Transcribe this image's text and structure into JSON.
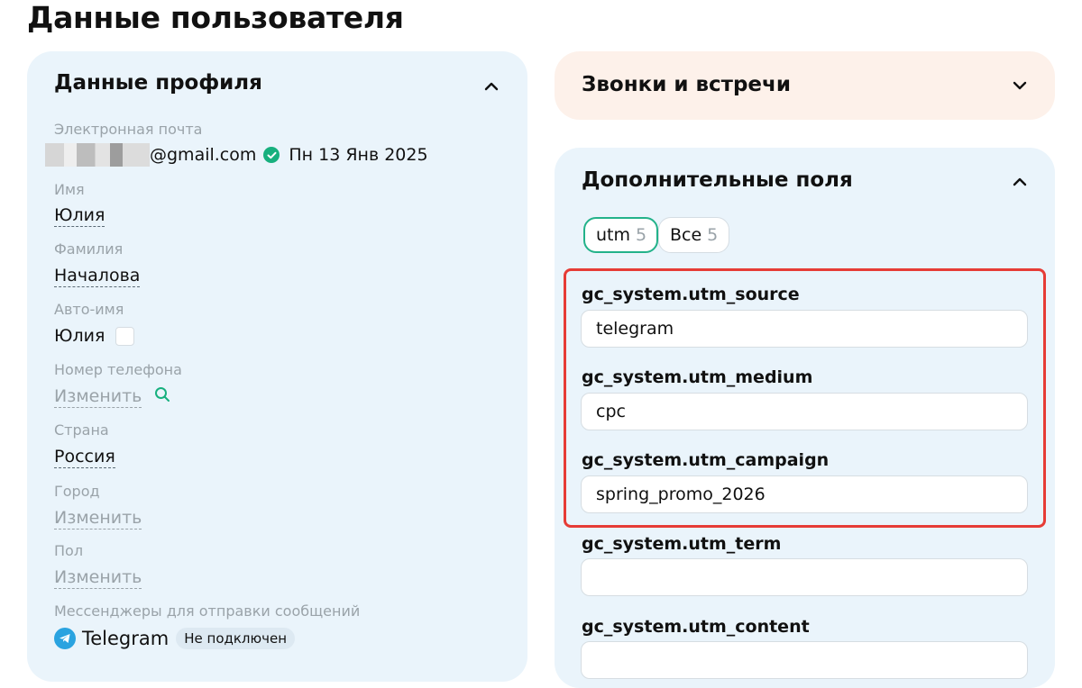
{
  "page": {
    "title": "Данные пользователя"
  },
  "profile": {
    "title": "Данные профиля",
    "email": {
      "label": "Электронная почта",
      "value": "@gmail.com",
      "date": "Пн 13 Янв 2025"
    },
    "first_name": {
      "label": "Имя",
      "value": "Юлия"
    },
    "last_name": {
      "label": "Фамилия",
      "value": "Началова"
    },
    "auto_name": {
      "label": "Авто-имя",
      "value": "Юлия"
    },
    "phone": {
      "label": "Номер телефона",
      "value": "Изменить"
    },
    "country": {
      "label": "Страна",
      "value": "Россия"
    },
    "city": {
      "label": "Город",
      "value": "Изменить"
    },
    "gender": {
      "label": "Пол",
      "value": "Изменить"
    },
    "messengers": {
      "label": "Мессенджеры для отправки сообщений",
      "telegram": "Telegram",
      "status": "Не подключен"
    }
  },
  "calls": {
    "title": "Звонки и встречи"
  },
  "extra": {
    "title": "Дополнительные поля",
    "tabs": [
      {
        "label": "utm",
        "count": "5",
        "active": true
      },
      {
        "label": "Все",
        "count": "5",
        "active": false
      }
    ],
    "fields": [
      {
        "label": "gc_system.utm_source",
        "value": "telegram"
      },
      {
        "label": "gc_system.utm_medium",
        "value": "cpc"
      },
      {
        "label": "gc_system.utm_campaign",
        "value": "spring_promo_2026"
      },
      {
        "label": "gc_system.utm_term",
        "value": ""
      },
      {
        "label": "gc_system.utm_content",
        "value": ""
      }
    ]
  },
  "colors": {
    "accent": "#23b28a",
    "highlight": "#e63c36",
    "card_blue": "#eaf4fb",
    "card_peach": "#fdf1ea"
  }
}
